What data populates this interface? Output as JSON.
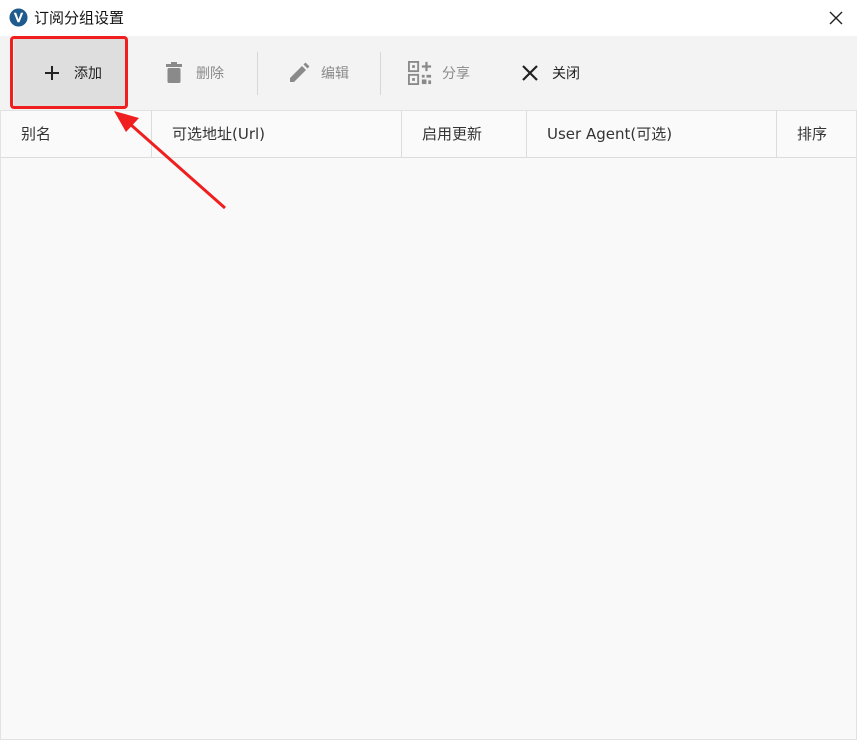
{
  "window": {
    "title": "订阅分组设置"
  },
  "toolbar": {
    "add_label": "添加",
    "delete_label": "删除",
    "edit_label": "编辑",
    "share_label": "分享",
    "close_label": "关闭"
  },
  "table": {
    "columns": [
      "别名",
      "可选地址(Url)",
      "启用更新",
      "User Agent(可选)",
      "排序"
    ],
    "rows": []
  },
  "colors": {
    "annotation": "#f01e1e",
    "toolbar_bg": "#f3f3f3",
    "table_bg": "#f9f9f9",
    "app_icon": "#1f5b8c"
  },
  "icons": {
    "app": "v2ray-app-icon",
    "add": "plus-icon",
    "delete": "trash-icon",
    "edit": "pencil-icon",
    "share": "qrcode-icon",
    "close": "close-icon"
  }
}
